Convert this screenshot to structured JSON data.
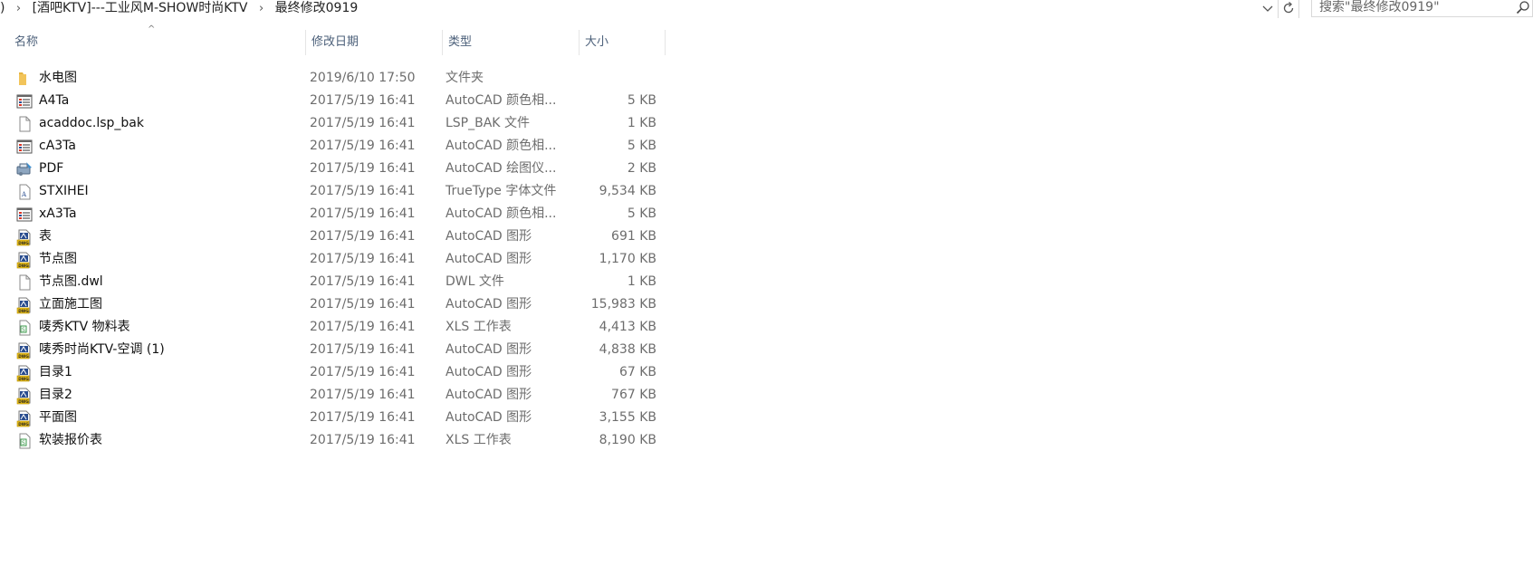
{
  "address_bar": {
    "breadcrumbs": [
      "[酒吧KTV]---工业风M-SHOW时尚KTV",
      "最终修改0919"
    ],
    "search_placeholder": "搜索\"最终修改0919\""
  },
  "columns": {
    "name": "名称",
    "date": "修改日期",
    "type": "类型",
    "size": "大小"
  },
  "files": [
    {
      "name": "水电图",
      "date": "2019/6/10 17:50",
      "type": "文件夹",
      "size": "",
      "icon": "folder-icon"
    },
    {
      "name": "A4Ta",
      "date": "2017/5/19 16:41",
      "type": "AutoCAD 颜色相...",
      "size": "5 KB",
      "icon": "ctb-file-icon"
    },
    {
      "name": "acaddoc.lsp_bak",
      "date": "2017/5/19 16:41",
      "type": "LSP_BAK 文件",
      "size": "1 KB",
      "icon": "generic-file-icon"
    },
    {
      "name": "cA3Ta",
      "date": "2017/5/19 16:41",
      "type": "AutoCAD 颜色相...",
      "size": "5 KB",
      "icon": "ctb-file-icon"
    },
    {
      "name": "PDF",
      "date": "2017/5/19 16:41",
      "type": "AutoCAD 绘图仪...",
      "size": "2 KB",
      "icon": "plotter-file-icon"
    },
    {
      "name": "STXIHEI",
      "date": "2017/5/19 16:41",
      "type": "TrueType 字体文件",
      "size": "9,534 KB",
      "icon": "font-file-icon"
    },
    {
      "name": "xA3Ta",
      "date": "2017/5/19 16:41",
      "type": "AutoCAD 颜色相...",
      "size": "5 KB",
      "icon": "ctb-file-icon"
    },
    {
      "name": "表",
      "date": "2017/5/19 16:41",
      "type": "AutoCAD 图形",
      "size": "691 KB",
      "icon": "dwg-file-icon"
    },
    {
      "name": "节点图",
      "date": "2017/5/19 16:41",
      "type": "AutoCAD 图形",
      "size": "1,170 KB",
      "icon": "dwg-file-icon"
    },
    {
      "name": "节点图.dwl",
      "date": "2017/5/19 16:41",
      "type": "DWL 文件",
      "size": "1 KB",
      "icon": "generic-file-icon"
    },
    {
      "name": "立面施工图",
      "date": "2017/5/19 16:41",
      "type": "AutoCAD 图形",
      "size": "15,983 KB",
      "icon": "dwg-file-icon"
    },
    {
      "name": "唛秀KTV 物料表",
      "date": "2017/5/19 16:41",
      "type": "XLS 工作表",
      "size": "4,413 KB",
      "icon": "xls-file-icon"
    },
    {
      "name": "唛秀时尚KTV-空调 (1)",
      "date": "2017/5/19 16:41",
      "type": "AutoCAD 图形",
      "size": "4,838 KB",
      "icon": "dwg-file-icon"
    },
    {
      "name": "目录1",
      "date": "2017/5/19 16:41",
      "type": "AutoCAD 图形",
      "size": "67 KB",
      "icon": "dwg-file-icon"
    },
    {
      "name": "目录2",
      "date": "2017/5/19 16:41",
      "type": "AutoCAD 图形",
      "size": "767 KB",
      "icon": "dwg-file-icon"
    },
    {
      "name": "平面图",
      "date": "2017/5/19 16:41",
      "type": "AutoCAD 图形",
      "size": "3,155 KB",
      "icon": "dwg-file-icon"
    },
    {
      "name": "软装报价表",
      "date": "2017/5/19 16:41",
      "type": "XLS 工作表",
      "size": "8,190 KB",
      "icon": "xls-file-icon"
    }
  ],
  "colors": {
    "header_text": "#4c607a",
    "secondary_text": "#6d6d6d",
    "folder": "#f2c45a",
    "dwg_yellow": "#f0c419",
    "dwg_blue": "#2a4d8f"
  }
}
